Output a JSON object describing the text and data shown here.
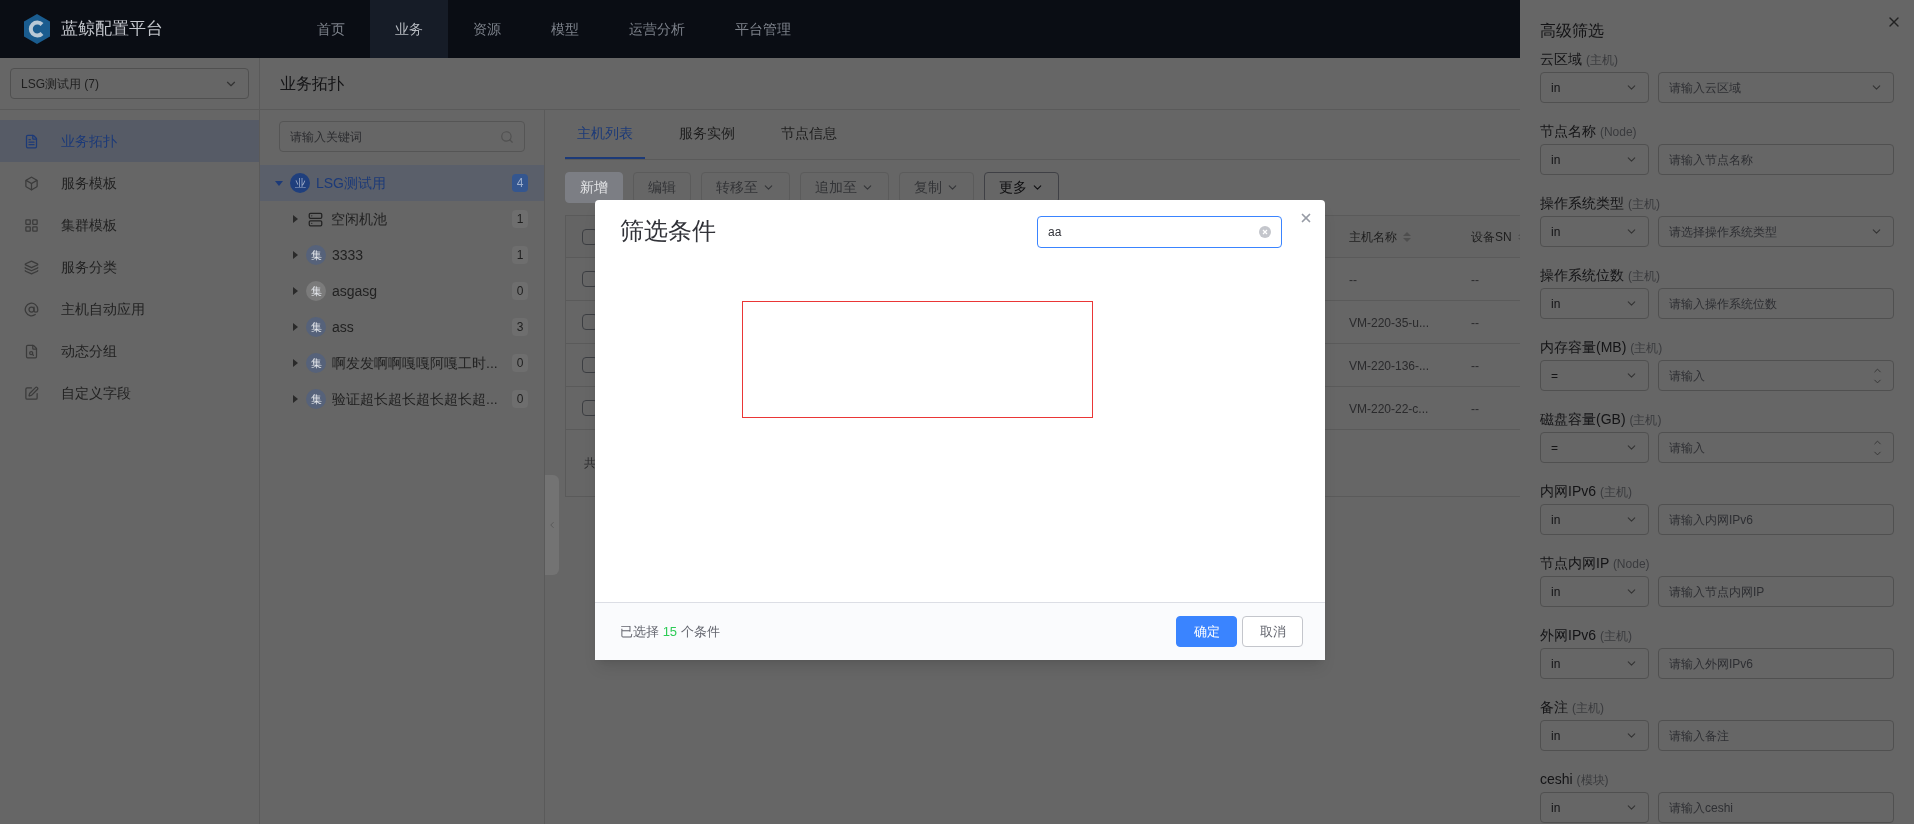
{
  "top_nav": {
    "logo_text": "蓝鲸配置平台",
    "items": [
      {
        "label": "首页",
        "selected": false
      },
      {
        "label": "业务",
        "selected": true
      },
      {
        "label": "资源",
        "selected": false
      },
      {
        "label": "模型",
        "selected": false
      },
      {
        "label": "运营分析",
        "selected": false
      },
      {
        "label": "平台管理",
        "selected": false
      }
    ]
  },
  "sidebar": {
    "business_select": "LSG测试用 (7)",
    "items": [
      {
        "label": "业务拓扑",
        "kind": "document",
        "selected": true
      },
      {
        "label": "服务模板",
        "kind": "cube",
        "selected": false
      },
      {
        "label": "集群模板",
        "kind": "grid",
        "selected": false
      },
      {
        "label": "服务分类",
        "kind": "layers",
        "selected": false
      },
      {
        "label": "主机自动应用",
        "kind": "at",
        "selected": false
      },
      {
        "label": "动态分组",
        "kind": "search",
        "selected": false
      },
      {
        "label": "自定义字段",
        "kind": "edit",
        "selected": false
      }
    ]
  },
  "page_title": "业务拓扑",
  "topology": {
    "search_placeholder": "请输入关键词",
    "root": {
      "label": "LSG测试用",
      "badge": "业",
      "count": "4",
      "expanded": true,
      "selected": true,
      "children": [
        {
          "label": "空闲机池",
          "kind": "pool",
          "count": "1",
          "expanded": false
        },
        {
          "label": "3333",
          "kind": "set",
          "badge": "集",
          "color": "#56627a",
          "count": "1",
          "expanded": false
        },
        {
          "label": "asgasg",
          "kind": "set",
          "badge": "集",
          "color": "#7b7b7b",
          "count": "0",
          "expanded": false
        },
        {
          "label": "ass",
          "kind": "set",
          "badge": "集",
          "color": "#56627a",
          "count": "3",
          "expanded": false
        },
        {
          "label": "啊发发啊啊嘎嘎阿嘎工时...",
          "kind": "set",
          "badge": "集",
          "color": "#56627a",
          "count": "0",
          "expanded": false
        },
        {
          "label": "验证超长超长超长超长超...",
          "kind": "set",
          "badge": "集",
          "color": "#56627a",
          "count": "0",
          "expanded": false
        }
      ]
    }
  },
  "tabs": [
    {
      "label": "主机列表",
      "selected": true
    },
    {
      "label": "服务实例",
      "selected": false
    },
    {
      "label": "节点信息",
      "selected": false
    }
  ],
  "toolbar": [
    {
      "label": "新增",
      "kind": "primary",
      "dropdown": false,
      "disabled": true
    },
    {
      "label": "编辑",
      "kind": "default",
      "dropdown": false,
      "disabled": true
    },
    {
      "label": "转移至",
      "kind": "default",
      "dropdown": true,
      "disabled": true
    },
    {
      "label": "追加至",
      "kind": "default",
      "dropdown": true,
      "disabled": true
    },
    {
      "label": "复制",
      "kind": "default",
      "dropdown": true,
      "disabled": true
    },
    {
      "label": "更多",
      "kind": "default",
      "dropdown": true,
      "disabled": false
    }
  ],
  "host_table": {
    "header_checked": false,
    "columns": [
      "主机名称",
      "设备SN"
    ],
    "rows": [
      {
        "checked": false,
        "cells": [
          "--",
          "--"
        ]
      },
      {
        "checked": false,
        "cells": [
          "VM-220-35-u...",
          "--"
        ]
      },
      {
        "checked": false,
        "cells": [
          "VM-220-136-...",
          "--"
        ]
      },
      {
        "checked": false,
        "cells": [
          "VM-220-22-c...",
          "--"
        ]
      }
    ],
    "footer": "共"
  },
  "modal": {
    "title": "筛选条件",
    "search_value": "aa",
    "summary_prefix": "已选择",
    "selected_count": "15",
    "summary_suffix": "个条件",
    "buttons": [
      {
        "label": "确定",
        "kind": "primary"
      },
      {
        "label": "取消",
        "kind": "default"
      }
    ]
  },
  "drawer": {
    "title": "高级筛选",
    "fields": [
      {
        "label": "云区域",
        "scope": "(主机)",
        "operator": "in",
        "placeholder": "请输入云区域",
        "kind": "select"
      },
      {
        "label": "节点名称",
        "scope": "(Node)",
        "operator": "in",
        "placeholder": "请输入节点名称",
        "kind": "text"
      },
      {
        "label": "操作系统类型",
        "scope": "(主机)",
        "operator": "in",
        "placeholder": "请选择操作系统类型",
        "kind": "select"
      },
      {
        "label": "操作系统位数",
        "scope": "(主机)",
        "operator": "in",
        "placeholder": "请输入操作系统位数",
        "kind": "text"
      },
      {
        "label": "内存容量(MB)",
        "scope": "(主机)",
        "operator": "=",
        "placeholder": "请输入",
        "kind": "number"
      },
      {
        "label": "磁盘容量(GB)",
        "scope": "(主机)",
        "operator": "=",
        "placeholder": "请输入",
        "kind": "number"
      },
      {
        "label": "内网IPv6",
        "scope": "(主机)",
        "operator": "in",
        "placeholder": "请输入内网IPv6",
        "kind": "text"
      },
      {
        "label": "节点内网IP",
        "scope": "(Node)",
        "operator": "in",
        "placeholder": "请输入节点内网IP",
        "kind": "text"
      },
      {
        "label": "外网IPv6",
        "scope": "(主机)",
        "operator": "in",
        "placeholder": "请输入外网IPv6",
        "kind": "text"
      },
      {
        "label": "备注",
        "scope": "(主机)",
        "operator": "in",
        "placeholder": "请输入备注",
        "kind": "text"
      },
      {
        "label": "ceshi",
        "scope": "(模块)",
        "operator": "in",
        "placeholder": "请输入ceshi",
        "kind": "text"
      }
    ]
  }
}
